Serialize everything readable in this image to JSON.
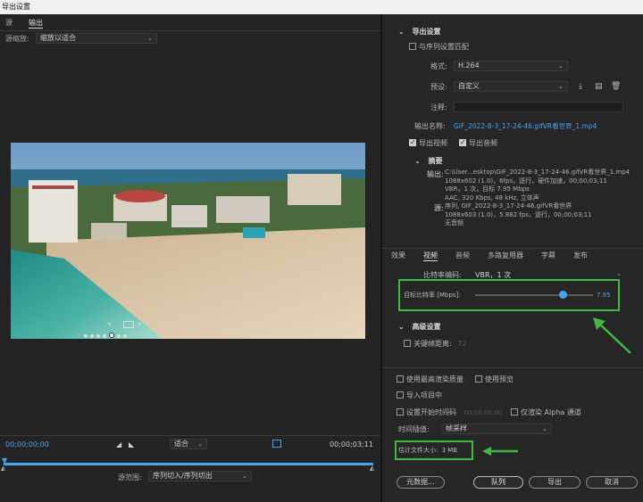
{
  "window": {
    "title": "导出设置"
  },
  "left": {
    "tabs": [
      {
        "label": "源"
      },
      {
        "label": "输出"
      }
    ],
    "source_scale_label": "源缩放:",
    "source_scale_value": "缩放以适合",
    "carousel_arrow_left": "«",
    "carousel_arrow_right": "»",
    "carousel_dots": 7,
    "timecode_start": "00;00;00;00",
    "timecode_end": "00;00;03;11",
    "fit_value": "适合",
    "range_label": "源范围:",
    "range_value": "序列切入/序列切出"
  },
  "export_settings": {
    "section_title": "导出设置",
    "match_sequence_label": "与序列设置匹配",
    "format_label": "格式:",
    "format_value": "H.264",
    "preset_label": "预设:",
    "preset_value": "自定义",
    "comment_label": "注释:",
    "comment_value": "",
    "output_name_label": "输出名称:",
    "output_name_value": "GIF_2022-8-3_17-24-46.gifVR看世界_1.mp4",
    "export_video_label": "导出视频",
    "export_audio_label": "导出音频"
  },
  "summary": {
    "title": "摘要",
    "output_label": "输出:",
    "output_lines": [
      "C:\\User...esktop\\GIF_2022-8-3_17-24-46.gifVR看世界_1.mp4",
      "1088x602 (1.0)，6fps，逐行，硬件加速，00;00;03;11",
      "VBR，1 次，目标 7.95 Mbps",
      "AAC, 320 Kbps, 48 kHz, 立体声"
    ],
    "source_label": "源:",
    "source_lines": [
      "序列, GIF_2022-8-3_17-24-46.gifVR看世界",
      "1088x603 (1.0)，5.882 fps，逐行，00;00;03;11",
      "无音频"
    ]
  },
  "settings_tabs": [
    {
      "label": "效果"
    },
    {
      "label": "视频"
    },
    {
      "label": "音频"
    },
    {
      "label": "多路复用器"
    },
    {
      "label": "字幕"
    },
    {
      "label": "发布"
    }
  ],
  "video": {
    "bitrate_encoding_label": "比特率编码:",
    "bitrate_encoding_value": "VBR，1 次",
    "target_bitrate_label": "目标比特率 [Mbps]:",
    "target_bitrate_value": "7.95",
    "target_bitrate_fraction": 0.74,
    "advanced_title": "高级设置",
    "keyframe_label": "关键帧距离:",
    "keyframe_value": "72"
  },
  "bottom": {
    "max_quality_label": "使用最高渲染质量",
    "use_preview_label": "使用预览",
    "import_project_label": "导入项目中",
    "set_start_tc_label": "设置开始时间码",
    "start_tc_value": "00;00;00;00",
    "alpha_only_label": "仅渲染 Alpha 通道",
    "interpolation_label": "时间插值:",
    "interpolation_value": "帧采样",
    "file_size_label": "估计文件大小:",
    "file_size_value": "3 MB",
    "metadata_button": "元数据...",
    "queue_button": "队列",
    "export_button": "导出",
    "cancel_button": "取消"
  },
  "colors": {
    "accent_blue": "#4aa3f0",
    "highlight_green": "#3fb93f",
    "panel_bg": "#262626",
    "window_bg": "#1e1e1e"
  }
}
